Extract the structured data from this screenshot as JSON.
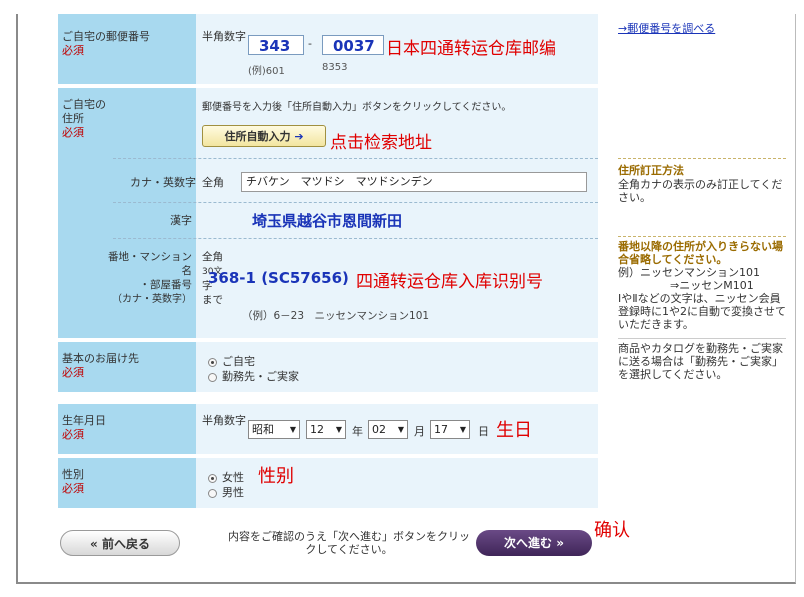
{
  "zip": {
    "label": "ご自宅の郵便番号",
    "required": "必須",
    "width_note": "半角数字",
    "part1": "343",
    "separator": "-",
    "part2": "0037",
    "example1": "(例)601",
    "example2": "8353",
    "annotation": "日本四通转运仓库邮编",
    "lookup_link": "→郵便番号を調べる"
  },
  "address": {
    "label_line1": "ご自宅の",
    "label_line2": "住所",
    "required": "必須",
    "instruction": "郵便番号を入力後「住所自動入力」ボタンをクリックしてください。",
    "auto_button": "住所自動入力",
    "auto_arrow": "➔",
    "auto_annotation": "点击检索地址",
    "kana_label": "カナ・英数字",
    "kana_width": "全角",
    "kana_value": "チバケン　マツドシ　マツドシンデン",
    "kanji_label": "漢字",
    "kanji_value": "埼玉県越谷市恩間新田",
    "street_label_1": "番地・マンション",
    "street_label_2": "名",
    "street_label_3": "・部屋番号",
    "street_label_4": "（カナ・英数字）",
    "street_width_1": "全角",
    "street_width_2": "30文",
    "street_width_3": "字",
    "street_width_4": "まで",
    "street_value": "368-1 (SC57656)",
    "street_annotation": "四通转运仓库入库识别号",
    "street_example": "（例）6－23　ニッセンマンション101"
  },
  "delivery": {
    "label": "基本のお届け先",
    "required": "必須",
    "option_home": "ご自宅",
    "option_work": "勤務先・ご実家"
  },
  "birth": {
    "label": "生年月日",
    "required": "必須",
    "width_note": "半角数字",
    "era": "昭和",
    "year": "12",
    "year_unit": "年",
    "month": "02",
    "month_unit": "月",
    "day": "17",
    "day_unit": "日",
    "annotation": "生日",
    "arrow": "▼"
  },
  "gender": {
    "label": "性別",
    "required": "必須",
    "female": "女性",
    "male": "男性",
    "annotation": "性别"
  },
  "sidebar": {
    "correction_title": "住所訂正方法",
    "correction_text": "全角カナの表示のみ訂正してください。",
    "omit_title": "番地以降の住所が入りきらない場合省略してください。",
    "omit_example_1": "例）ニッセンマンション101",
    "omit_example_2": "⇒ニッセンM101",
    "omit_note": "ⅠやⅡなどの文字は、ニッセン会員登録時に1や2に自動で変換させていただきます。",
    "catalog_note": "商品やカタログを勤務先・ご実家に送る場合は「勤務先・ご実家」を選択してください。"
  },
  "footer": {
    "back_button": "« 前へ戻る",
    "confirm_text": "内容をご確認のうえ「次へ進む」ボタンをクリックしてください。",
    "next_button": "次へ進む »",
    "annotation": "确认"
  }
}
